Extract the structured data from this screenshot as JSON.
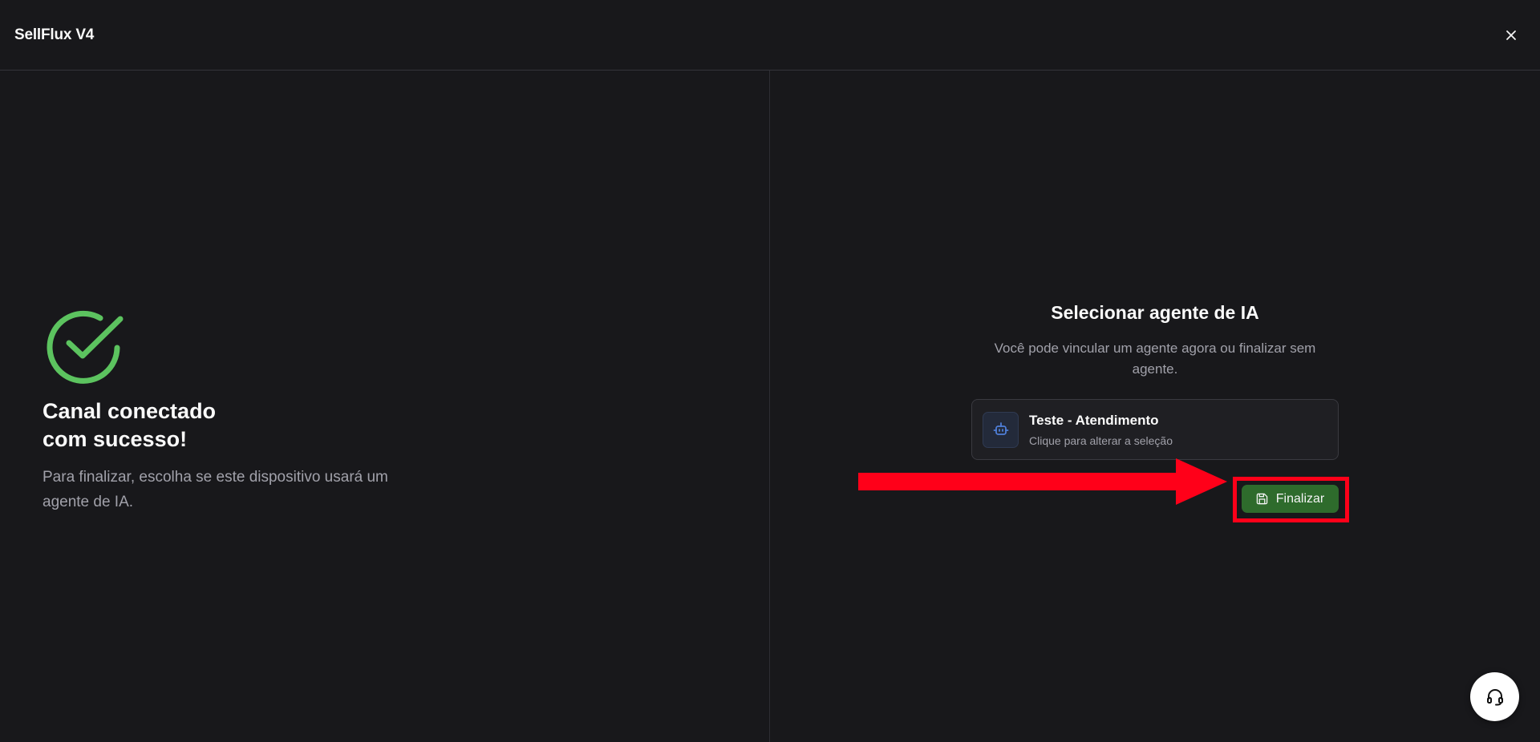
{
  "header": {
    "app_title": "SellFlux V4"
  },
  "left": {
    "title_line1": "Canal conectado",
    "title_line2": "com sucesso!",
    "description": "Para finalizar, escolha se este dispositivo usará um agente de IA."
  },
  "right": {
    "title": "Selecionar agente de IA",
    "description": "Você pode vincular um agente agora ou finalizar sem agente.",
    "agent_card": {
      "name": "Teste - Atendimento",
      "hint": "Clique para alterar a seleção",
      "icon": "bot-icon"
    },
    "finalize_label": "Finalizar"
  },
  "icons": {
    "close": "close-icon",
    "success": "check-circle-icon",
    "save": "save-icon",
    "support": "headset-icon"
  },
  "colors": {
    "background": "#18181b",
    "success_green": "#5cc35f",
    "finalize_bg": "#2e6b2c",
    "annotation_red": "#ff0019",
    "agent_icon_blue": "#4f7fd9"
  }
}
